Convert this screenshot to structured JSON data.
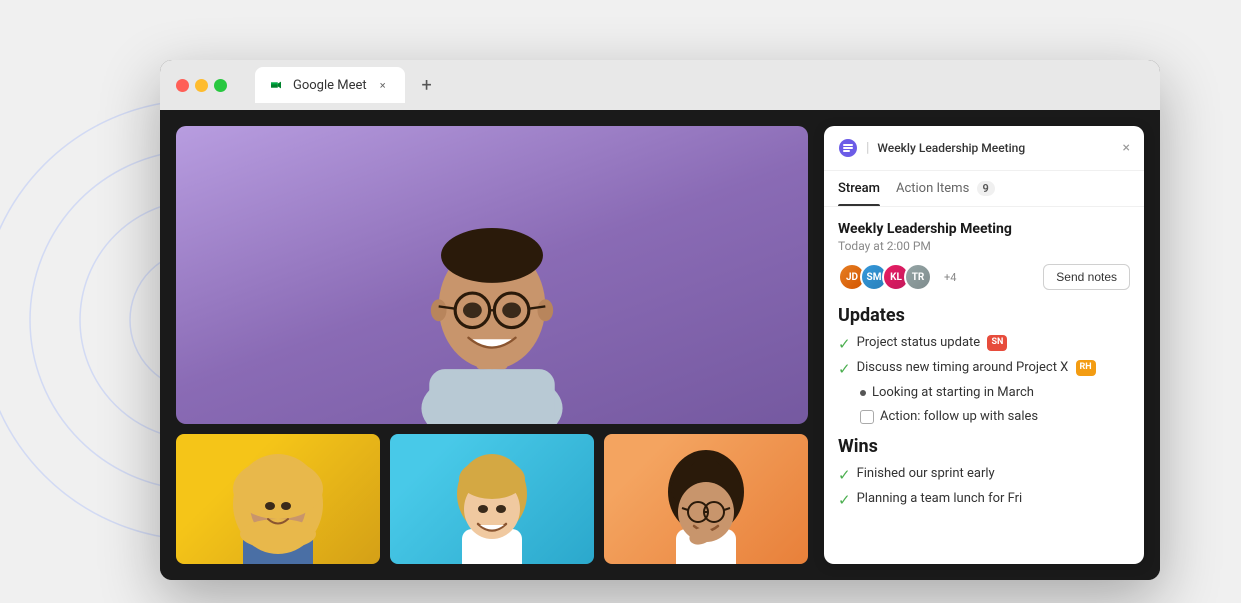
{
  "browser": {
    "tab_label": "Google Meet",
    "close_symbol": "×",
    "new_tab_symbol": "+"
  },
  "notes_panel": {
    "logo_label": "notes-logo",
    "separator": "|",
    "title": "Weekly Leadership Meeting",
    "close_symbol": "×",
    "tabs": [
      {
        "label": "Stream",
        "active": true
      },
      {
        "label": "Action Items",
        "active": false,
        "badge": "9"
      }
    ],
    "meeting": {
      "title": "Weekly Leadership Meeting",
      "time": "Today at 2:00 PM",
      "attendees_extra": "+4",
      "send_notes_label": "Send notes"
    },
    "sections": [
      {
        "title": "Updates",
        "items": [
          {
            "type": "checked",
            "text": "Project status update",
            "badge": "SN",
            "badge_class": "badge-sn"
          },
          {
            "type": "checked",
            "text": "Discuss new timing around Project X",
            "badge": "RH",
            "badge_class": "badge-rh"
          },
          {
            "type": "bullet",
            "text": "Looking at starting in March"
          },
          {
            "type": "action",
            "text": "Action: follow up with sales"
          }
        ]
      },
      {
        "title": "Wins",
        "items": [
          {
            "type": "checked",
            "text": "Finished our sprint early"
          },
          {
            "type": "checked",
            "text": "Planning a team lunch for Fri"
          }
        ]
      }
    ]
  },
  "decorative": {
    "circles": true,
    "wavy_lines": true
  }
}
